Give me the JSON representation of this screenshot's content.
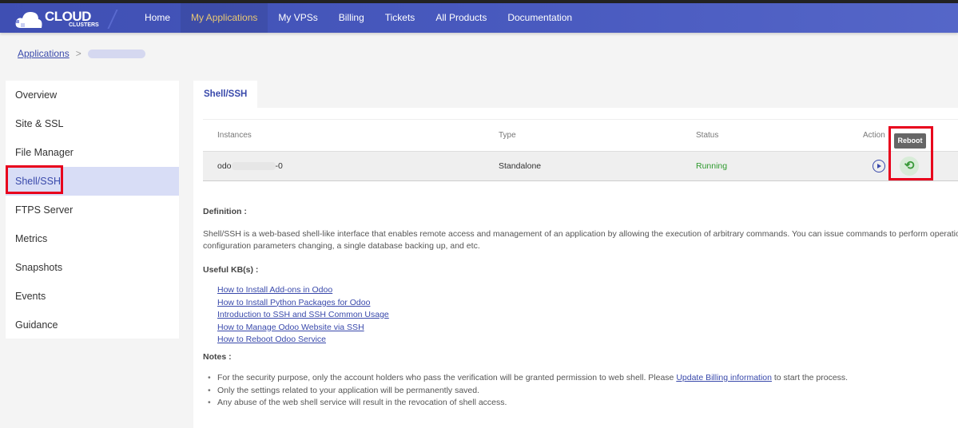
{
  "brand": {
    "line1": "CLOUD",
    "line2": "CLUSTERS"
  },
  "nav": [
    {
      "label": "Home"
    },
    {
      "label": "My Applications",
      "active": true
    },
    {
      "label": "My VPSs"
    },
    {
      "label": "Billing"
    },
    {
      "label": "Tickets"
    },
    {
      "label": "All Products"
    },
    {
      "label": "Documentation"
    }
  ],
  "breadcrumb": {
    "root": "Applications",
    "sep": ">"
  },
  "sidebar": [
    "Overview",
    "Site & SSL",
    "File Manager",
    "Shell/SSH",
    "FTPS Server",
    "Metrics",
    "Snapshots",
    "Events",
    "Guidance"
  ],
  "tab": "Shell/SSH",
  "table": {
    "headers": [
      "Instances",
      "Type",
      "Status",
      "Action"
    ],
    "row": {
      "instance_prefix": "odo",
      "instance_suffix": "-0",
      "type": "Standalone",
      "status": "Running"
    },
    "tooltip": "Reboot"
  },
  "definition": {
    "title": "Definition :",
    "text1": "Shell/SSH is a web-based shell-like interface that enables remote access and management of an application by allowing the execution of arbitrary commands. You can issue commands to perform operations",
    "text2": "configuration parameters changing, a single database backing up, and etc."
  },
  "kb": {
    "title": "Useful KB(s) :",
    "links": [
      "How to Install Add-ons in Odoo",
      "How to Install Python Packages for Odoo",
      "Introduction to SSH and SSH Common Usage",
      "How to Manage Odoo Website via SSH",
      "How to Reboot Odoo Service"
    ]
  },
  "notes": {
    "title": "Notes :",
    "n1a": "For the security purpose, only the account holders who pass the verification will be granted permission to web shell. Please ",
    "n1link": "Update Billing information",
    "n1b": " to start the process.",
    "n2": "Only the settings related to your application will be permanently saved.",
    "n3": "Any abuse of the web shell service will result in the revocation of shell access."
  },
  "colors": {
    "nav": "#3f4fb3",
    "accent": "#3949ab",
    "active_nav": "#e8c773",
    "running": "#2e9a2e",
    "highlight": "#e8001c"
  }
}
